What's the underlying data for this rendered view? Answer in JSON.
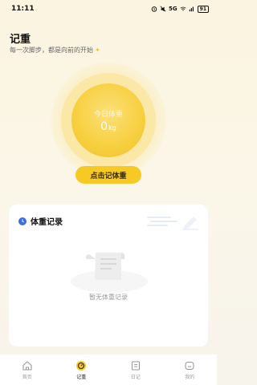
{
  "status_bar": {
    "time": "11:11",
    "network": "5G",
    "battery": "91"
  },
  "header": {
    "title": "记重",
    "subtitle": "每一次脚步，都是向前的开始"
  },
  "weight_display": {
    "label": "今日体重",
    "value": "0",
    "unit": "kg"
  },
  "record_button": {
    "label": "点击记体重"
  },
  "records_card": {
    "title": "体重记录",
    "empty_text": "暂无体重记录"
  },
  "bottom_nav": {
    "items": [
      {
        "label": "首页",
        "icon": "home-icon",
        "active": false
      },
      {
        "label": "记重",
        "icon": "scale-icon",
        "active": true
      },
      {
        "label": "日记",
        "icon": "diary-icon",
        "active": false
      },
      {
        "label": "我的",
        "icon": "profile-icon",
        "active": false
      }
    ]
  },
  "colors": {
    "accent": "#F6C925",
    "circle": "#F7CF3E",
    "background": "#FBF4DF"
  }
}
